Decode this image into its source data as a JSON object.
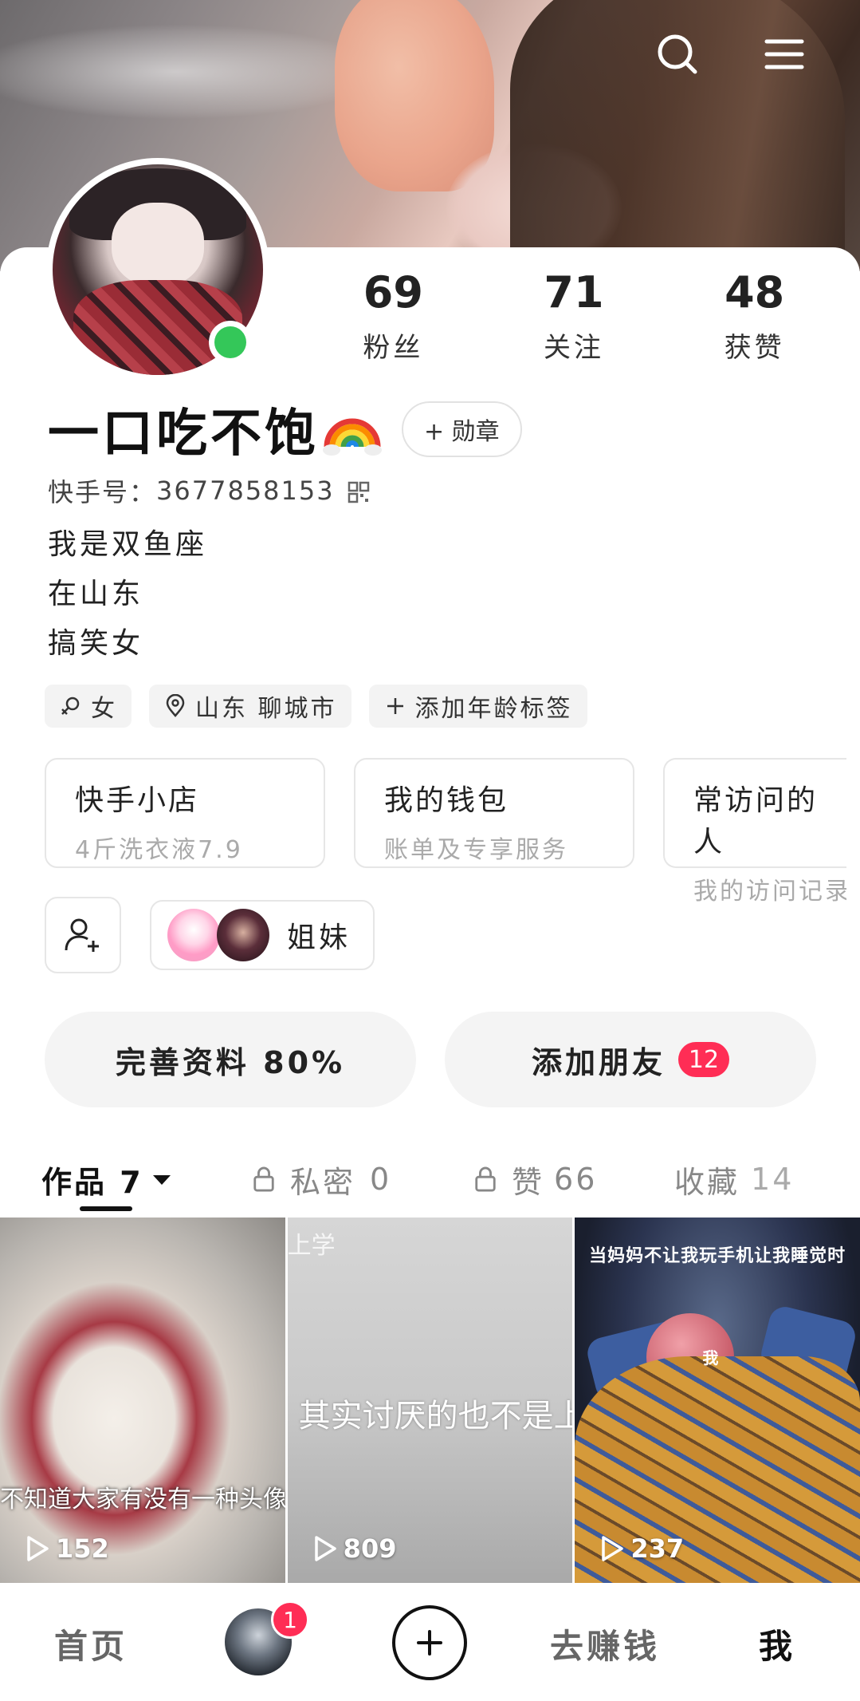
{
  "header": {
    "search_icon": "search-icon",
    "menu_icon": "menu-icon"
  },
  "profile": {
    "stats": [
      {
        "value": "69",
        "label": "粉丝"
      },
      {
        "value": "71",
        "label": "关注"
      },
      {
        "value": "48",
        "label": "获赞"
      }
    ],
    "nickname": "一口吃不饱",
    "medal_label": "+ 勋章",
    "kuaishou_id_label": "快手号：",
    "kuaishou_id": "3677858153",
    "bio": [
      "我是双鱼座",
      "在山东",
      "搞笑女"
    ],
    "tags": [
      {
        "icon": "female-icon",
        "label": "女"
      },
      {
        "icon": "location-icon",
        "label": "山东 聊城市"
      },
      {
        "icon": "plus-icon",
        "label": "添加年龄标签"
      }
    ],
    "cards": [
      {
        "title": "快手小店",
        "subtitle": "4斤洗衣液7.9"
      },
      {
        "title": "我的钱包",
        "subtitle": "账单及专享服务"
      },
      {
        "title": "常访问的人",
        "subtitle": "我的访问记录"
      }
    ],
    "group_name": "姐妹",
    "complete_profile": "完善资料 80%",
    "add_friends": "添加朋友",
    "add_friends_badge": "12"
  },
  "tabs": {
    "works": "作品 7",
    "private_label": "私密",
    "private_count": "0",
    "likes_label": "赞",
    "likes_count": "66",
    "favorites_label": "收藏",
    "favorites_count": "14"
  },
  "videos": [
    {
      "plays": "152",
      "caption": "不知道大家有没有一种头像"
    },
    {
      "plays": "809",
      "caption": "其实讨厌的也不是上学",
      "top_caption": "上学"
    },
    {
      "plays": "237",
      "caption": "当妈妈不让我玩手机让我睡觉时",
      "inner_caption": "我"
    }
  ],
  "bottom_nav": {
    "home": "首页",
    "earn": "去赚钱",
    "me": "我",
    "badge": "1"
  }
}
